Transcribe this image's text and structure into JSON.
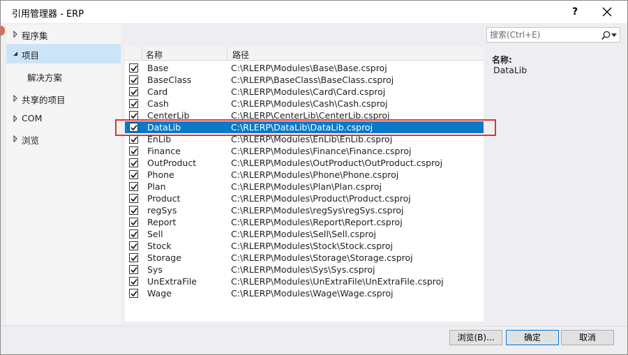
{
  "window": {
    "title": "引用管理器 - ERP",
    "help": "?"
  },
  "nav": {
    "items": [
      {
        "label": "程序集",
        "expanded": false
      },
      {
        "label": "项目",
        "expanded": true
      },
      {
        "label": "解决方案"
      },
      {
        "label": "共享的项目",
        "expanded": false
      },
      {
        "label": "COM",
        "expanded": false
      },
      {
        "label": "浏览",
        "expanded": false
      }
    ]
  },
  "list": {
    "headers": {
      "name": "名称",
      "path": "路径"
    },
    "rows": [
      {
        "name": "Base",
        "path": "C:\\RLERP\\Modules\\Base\\Base.csproj",
        "checked": true
      },
      {
        "name": "BaseClass",
        "path": "C:\\RLERP\\BaseClass\\BaseClass.csproj",
        "checked": true
      },
      {
        "name": "Card",
        "path": "C:\\RLERP\\Modules\\Card\\Card.csproj",
        "checked": true
      },
      {
        "name": "Cash",
        "path": "C:\\RLERP\\Modules\\Cash\\Cash.csproj",
        "checked": true
      },
      {
        "name": "CenterLib",
        "path": "C:\\RLERP\\CenterLib\\CenterLib.csproj",
        "checked": true
      },
      {
        "name": "DataLib",
        "path": "C:\\RLERP\\DataLib\\DataLib.csproj",
        "checked": true,
        "selected": true
      },
      {
        "name": "EnLib",
        "path": "C:\\RLERP\\Modules\\EnLib\\EnLib.csproj",
        "checked": true
      },
      {
        "name": "Finance",
        "path": "C:\\RLERP\\Modules\\Finance\\Finance.csproj",
        "checked": true
      },
      {
        "name": "OutProduct",
        "path": "C:\\RLERP\\Modules\\OutProduct\\OutProduct.csproj",
        "checked": true
      },
      {
        "name": "Phone",
        "path": "C:\\RLERP\\Modules\\Phone\\Phone.csproj",
        "checked": true
      },
      {
        "name": "Plan",
        "path": "C:\\RLERP\\Modules\\Plan\\Plan.csproj",
        "checked": true
      },
      {
        "name": "Product",
        "path": "C:\\RLERP\\Modules\\Product\\Product.csproj",
        "checked": true
      },
      {
        "name": "regSys",
        "path": "C:\\RLERP\\Modules\\regSys\\regSys.csproj",
        "checked": true
      },
      {
        "name": "Report",
        "path": "C:\\RLERP\\Modules\\Report\\Report.csproj",
        "checked": true
      },
      {
        "name": "Sell",
        "path": "C:\\RLERP\\Modules\\Sell\\Sell.csproj",
        "checked": true
      },
      {
        "name": "Stock",
        "path": "C:\\RLERP\\Modules\\Stock\\Stock.csproj",
        "checked": true
      },
      {
        "name": "Storage",
        "path": "C:\\RLERP\\Modules\\Storage\\Storage.csproj",
        "checked": true
      },
      {
        "name": "Sys",
        "path": "C:\\RLERP\\Modules\\Sys\\Sys.csproj",
        "checked": true
      },
      {
        "name": "UnExtraFile",
        "path": "C:\\RLERP\\Modules\\UnExtraFile\\UnExtraFile.csproj",
        "checked": true
      },
      {
        "name": "Wage",
        "path": "C:\\RLERP\\Modules\\Wage\\Wage.csproj",
        "checked": true
      }
    ]
  },
  "search": {
    "placeholder": "搜索(Ctrl+E)"
  },
  "details": {
    "name_label": "名称:",
    "name_value": "DataLib"
  },
  "buttons": {
    "browse": "浏览(B)...",
    "ok": "确定",
    "cancel": "取消"
  },
  "colors": {
    "selection": "#0a7ac8",
    "nav_selected": "#cce4f7",
    "annotation": "#e03232"
  }
}
